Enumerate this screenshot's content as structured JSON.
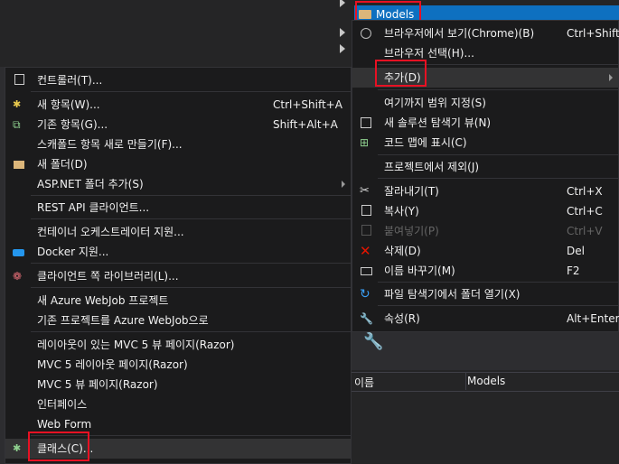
{
  "tree": {
    "selected_label": "Models"
  },
  "properties": {
    "name_label": "이름",
    "name_value": "Models"
  },
  "left_menu": {
    "items": [
      {
        "label": "컨트롤러(T)..."
      },
      {
        "label": "새 항목(W)...",
        "shortcut": "Ctrl+Shift+A"
      },
      {
        "label": "기존 항목(G)...",
        "shortcut": "Shift+Alt+A"
      },
      {
        "label": "스캐폴드 항목 새로 만들기(F)..."
      },
      {
        "label": "새 폴더(D)"
      },
      {
        "label": "ASP.NET 폴더 추가(S)"
      },
      {
        "label": "REST API 클라이언트..."
      },
      {
        "label": "컨테이너 오케스트레이터 지원..."
      },
      {
        "label": "Docker 지원..."
      },
      {
        "label": "클라이언트 쪽 라이브러리(L)..."
      },
      {
        "label": "새 Azure WebJob 프로젝트"
      },
      {
        "label": "기존 프로젝트를 Azure WebJob으로"
      },
      {
        "label": "레이아웃이 있는 MVC 5 뷰 페이지(Razor)"
      },
      {
        "label": "MVC 5 레이아웃 페이지(Razor)"
      },
      {
        "label": "MVC 5 뷰 페이지(Razor)"
      },
      {
        "label": "인터페이스"
      },
      {
        "label": "Web Form"
      },
      {
        "label": "클래스(C)..."
      }
    ]
  },
  "right_menu": {
    "items": [
      {
        "label": "브라우저에서 보기(Chrome)(B)",
        "shortcut": "Ctrl+Shift+"
      },
      {
        "label": "브라우저 선택(H)..."
      },
      {
        "label": "추가(D)"
      },
      {
        "label": "여기까지 범위 지정(S)"
      },
      {
        "label": "새 솔루션 탐색기 뷰(N)"
      },
      {
        "label": "코드 맵에 표시(C)"
      },
      {
        "label": "프로젝트에서 제외(J)"
      },
      {
        "label": "잘라내기(T)",
        "shortcut": "Ctrl+X"
      },
      {
        "label": "복사(Y)",
        "shortcut": "Ctrl+C"
      },
      {
        "label": "붙여넣기(P)",
        "shortcut": "Ctrl+V"
      },
      {
        "label": "삭제(D)",
        "shortcut": "Del"
      },
      {
        "label": "이름 바꾸기(M)",
        "shortcut": "F2"
      },
      {
        "label": "파일 탐색기에서 폴더 열기(X)"
      },
      {
        "label": "속성(R)",
        "shortcut": "Alt+Enter"
      }
    ]
  },
  "colors": {
    "highlight": "#e81123",
    "selection": "#0e70c0",
    "menu_bg": "#1b1b1c"
  }
}
